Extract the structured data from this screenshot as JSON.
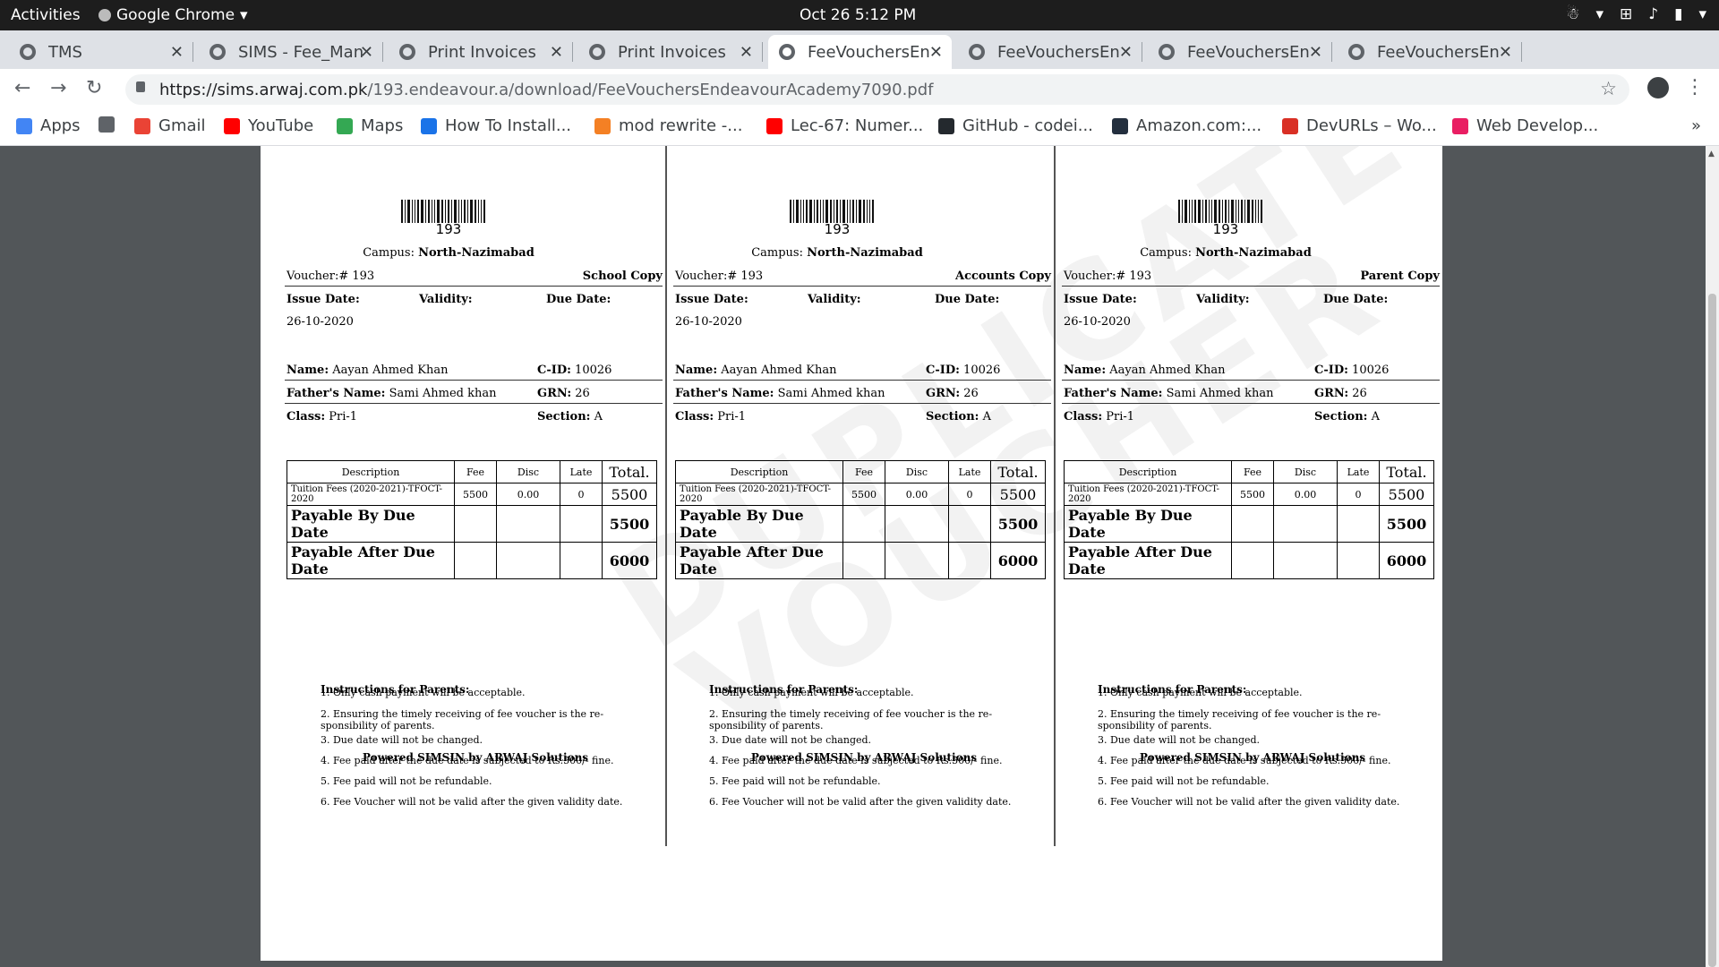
{
  "topbar": {
    "activities": "Activities",
    "app_name": "Google Chrome",
    "clock": "Oct 26   5:12 PM"
  },
  "tabs": [
    {
      "title": "TMS",
      "active": false
    },
    {
      "title": "SIMS - Fee_Man",
      "active": false
    },
    {
      "title": "Print Invoices",
      "active": false
    },
    {
      "title": "Print Invoices",
      "active": false
    },
    {
      "title": "FeeVouchersEn",
      "active": true
    },
    {
      "title": "FeeVouchersEn",
      "active": false
    },
    {
      "title": "FeeVouchersEn",
      "active": false
    },
    {
      "title": "FeeVouchersEn",
      "active": false
    }
  ],
  "omnibox": {
    "url_host": "https://sims.arwaj.com.pk",
    "url_path": "/193.endeavour.a/download/FeeVouchersEndeavourAcademy7090.pdf"
  },
  "bookmarks": [
    {
      "label": "Apps",
      "icon": "apps-icon"
    },
    {
      "label": "",
      "icon": "globe-icon"
    },
    {
      "label": "Gmail",
      "icon": "google-icon"
    },
    {
      "label": "YouTube",
      "icon": "youtube-icon"
    },
    {
      "label": "Maps",
      "icon": "maps-icon"
    },
    {
      "label": "How To Install...",
      "icon": "loading-icon"
    },
    {
      "label": "mod rewrite -...",
      "icon": "stackoverflow-icon"
    },
    {
      "label": "Lec-67: Numer...",
      "icon": "youtube-icon"
    },
    {
      "label": "GitHub - codei...",
      "icon": "github-icon"
    },
    {
      "label": "Amazon.com:...",
      "icon": "amazon-icon"
    },
    {
      "label": "DevURLs – Wo...",
      "icon": "devurls-icon"
    },
    {
      "label": "Web Develop...",
      "icon": "web-dev-icon"
    }
  ],
  "bookmarks_more": "»",
  "document": {
    "watermark_lines": [
      "DUPLICATE",
      "VOUCHER"
    ],
    "vouchers": [
      {
        "barcode_number": "193",
        "campus_label": "Campus:",
        "campus": "North-Nazimabad",
        "voucher_no": "Voucher:# 193",
        "copy_label": "School Copy",
        "issue_label": "Issue Date:",
        "validity_label": "Validity:",
        "due_label": "Due Date:",
        "issue_date": "26-10-2020",
        "name_label": "Name:",
        "name": "Aayan Ahmed Khan",
        "cid_label": "C-ID:",
        "cid": "10026",
        "father_label": "Father's Name:",
        "father": "Sami Ahmed khan",
        "grn_label": "GRN:",
        "grn": "26",
        "class_label": "Class:",
        "class": "Pri-1",
        "section_label": "Section:",
        "section": "A",
        "table": {
          "headers": [
            "Description",
            "Fee",
            "Disc",
            "Late",
            "Total."
          ],
          "row": {
            "description": "Tuition Fees (2020-2021)-TFOCT-2020",
            "fee": "5500",
            "disc": "0.00",
            "late": "0",
            "total": "5500"
          },
          "payable_by_label": "Payable By Due Date",
          "payable_by": "5500",
          "payable_after_label": "Payable After Due Date",
          "payable_after": "6000"
        },
        "instructions_title": "Instructions for Parents:",
        "instructions": [
          "1. Only cash payment will be acceptable.",
          "2.  Ensuring the timely receiving of fee voucher is the re-sponsibility of parents.",
          "3. Due date will not be changed.",
          "4. Fee paid after the due date is subjected to Rs.500/- fine.",
          "5. Fee paid will not be refundable.",
          "6. Fee Voucher will not be valid after the given validity date."
        ],
        "powered": "Powered SIMSIN by ARWAJ Solutions"
      },
      {
        "barcode_number": "193",
        "campus_label": "Campus:",
        "campus": "North-Nazimabad",
        "voucher_no": "Voucher:# 193",
        "copy_label": "Accounts Copy",
        "issue_label": "Issue Date:",
        "validity_label": "Validity:",
        "due_label": "Due Date:",
        "issue_date": "26-10-2020",
        "name_label": "Name:",
        "name": "Aayan Ahmed Khan",
        "cid_label": "C-ID:",
        "cid": "10026",
        "father_label": "Father's Name:",
        "father": "Sami Ahmed khan",
        "grn_label": "GRN:",
        "grn": "26",
        "class_label": "Class:",
        "class": "Pri-1",
        "section_label": "Section:",
        "section": "A",
        "table": {
          "headers": [
            "Description",
            "Fee",
            "Disc",
            "Late",
            "Total."
          ],
          "row": {
            "description": "Tuition Fees (2020-2021)-TFOCT-2020",
            "fee": "5500",
            "disc": "0.00",
            "late": "0",
            "total": "5500"
          },
          "payable_by_label": "Payable By Due Date",
          "payable_by": "5500",
          "payable_after_label": "Payable After Due Date",
          "payable_after": "6000"
        },
        "instructions_title": "Instructions for Parents:",
        "instructions": [
          "1. Only cash payment will be acceptable.",
          "2.  Ensuring the timely receiving of fee voucher is the re-sponsibility of parents.",
          "3. Due date will not be changed.",
          "4. Fee paid after the due date is subjected to Rs.500/- fine.",
          "5. Fee paid will not be refundable.",
          "6. Fee Voucher will not be valid after the given validity date."
        ],
        "powered": "Powered SIMSIN by ARWAJ Solutions"
      },
      {
        "barcode_number": "193",
        "campus_label": "Campus:",
        "campus": "North-Nazimabad",
        "voucher_no": "Voucher:# 193",
        "copy_label": "Parent Copy",
        "issue_label": "Issue Date:",
        "validity_label": "Validity:",
        "due_label": "Due Date:",
        "issue_date": "26-10-2020",
        "name_label": "Name:",
        "name": "Aayan Ahmed Khan",
        "cid_label": "C-ID:",
        "cid": "10026",
        "father_label": "Father's Name:",
        "father": "Sami Ahmed khan",
        "grn_label": "GRN:",
        "grn": "26",
        "class_label": "Class:",
        "class": "Pri-1",
        "section_label": "Section:",
        "section": "A",
        "table": {
          "headers": [
            "Description",
            "Fee",
            "Disc",
            "Late",
            "Total."
          ],
          "row": {
            "description": "Tuition Fees (2020-2021)-TFOCT-2020",
            "fee": "5500",
            "disc": "0.00",
            "late": "0",
            "total": "5500"
          },
          "payable_by_label": "Payable By Due Date",
          "payable_by": "5500",
          "payable_after_label": "Payable After Due Date",
          "payable_after": "6000"
        },
        "instructions_title": "Instructions for Parents:",
        "instructions": [
          "1. Only cash payment will be acceptable.",
          "2.  Ensuring the timely receiving of fee voucher is the re-sponsibility of parents.",
          "3. Due date will not be changed.",
          "4. Fee paid after the due date is subjected to Rs.500/- fine.",
          "5. Fee paid will not be refundable.",
          "6. Fee Voucher will not be valid after the given validity date."
        ],
        "powered": "Powered SIMSIN by ARWAJ Solutions"
      }
    ]
  }
}
